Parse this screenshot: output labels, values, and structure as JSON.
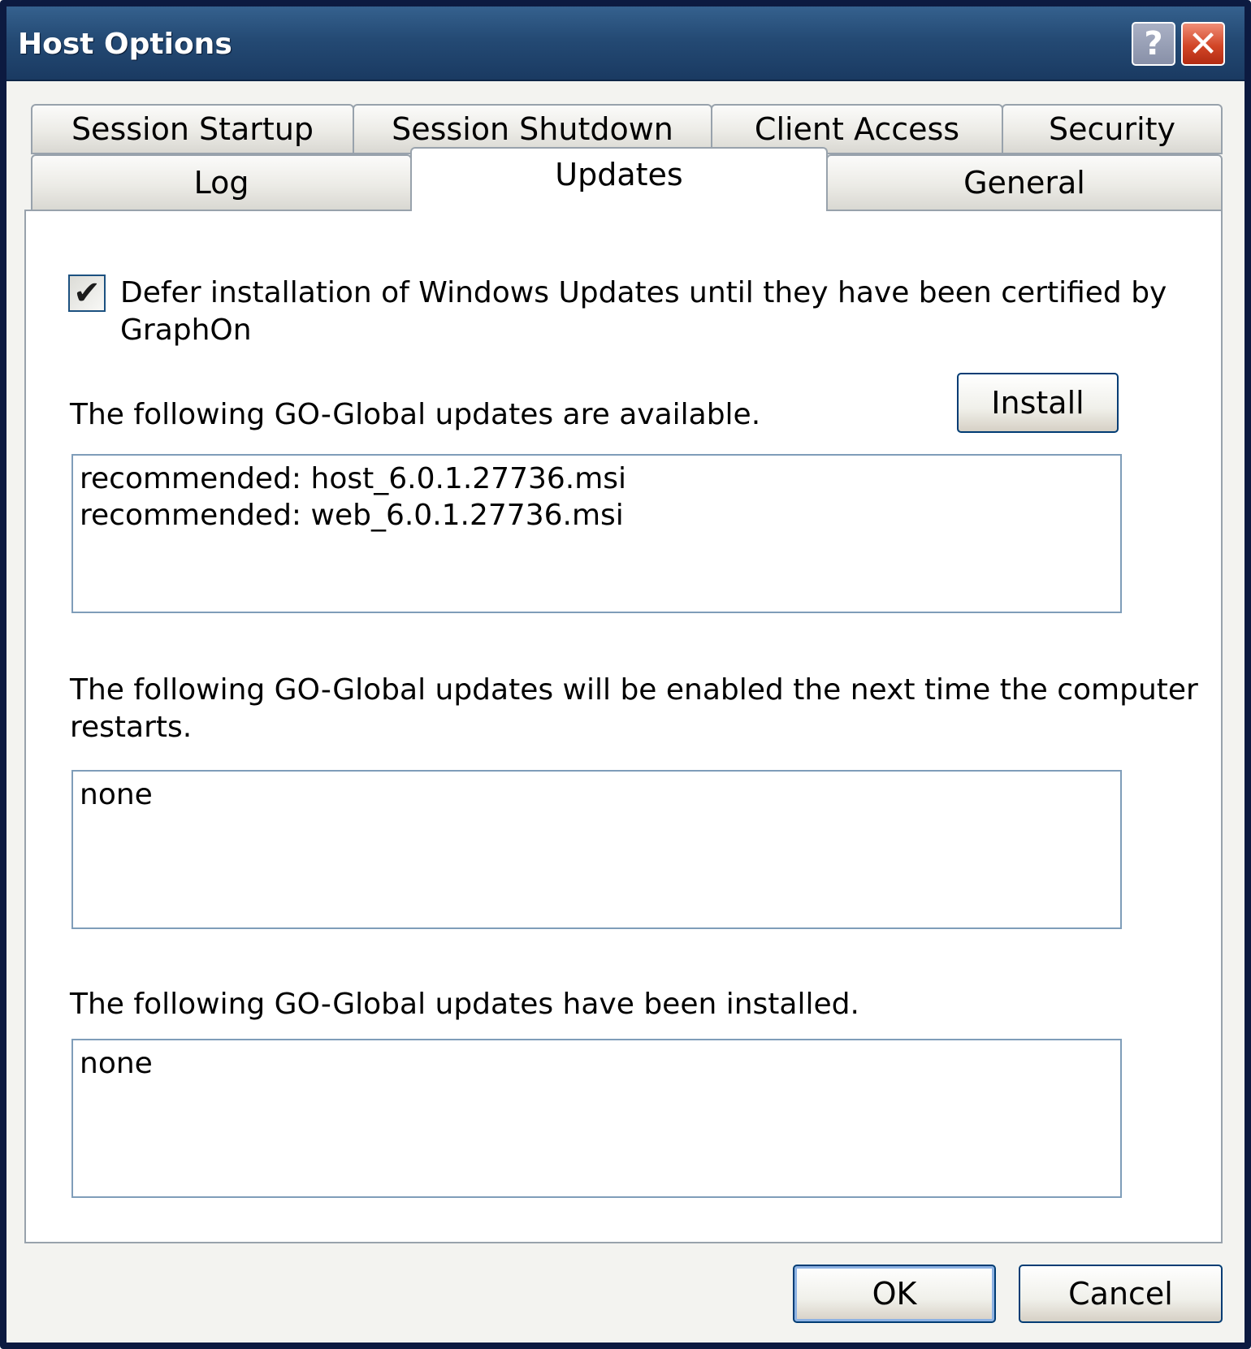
{
  "window": {
    "title": "Host Options",
    "help_label": "?",
    "close_label": "✕"
  },
  "tabs": {
    "row1": [
      "Session Startup",
      "Session Shutdown",
      "Client Access",
      "Security"
    ],
    "row2": [
      "Log",
      "Updates",
      "General"
    ],
    "selected": "Updates"
  },
  "updates": {
    "defer_checkbox": {
      "checked": true,
      "mark": "✔",
      "label_line1": "Defer installation of Windows Updates until they have been certified by",
      "label_line2": "GraphOn"
    },
    "available": {
      "label": "The following GO-Global updates are available.",
      "items": [
        "recommended: host_6.0.1.27736.msi",
        "recommended: web_6.0.1.27736.msi"
      ]
    },
    "install_button": "Install",
    "pending": {
      "label_line1": "The following GO-Global updates will be enabled the next time the computer",
      "label_line2": "restarts.",
      "items": [
        "none"
      ]
    },
    "installed": {
      "label": "The following GO-Global updates have been installed.",
      "items": [
        "none"
      ]
    }
  },
  "footer": {
    "ok": "OK",
    "cancel": "Cancel"
  }
}
